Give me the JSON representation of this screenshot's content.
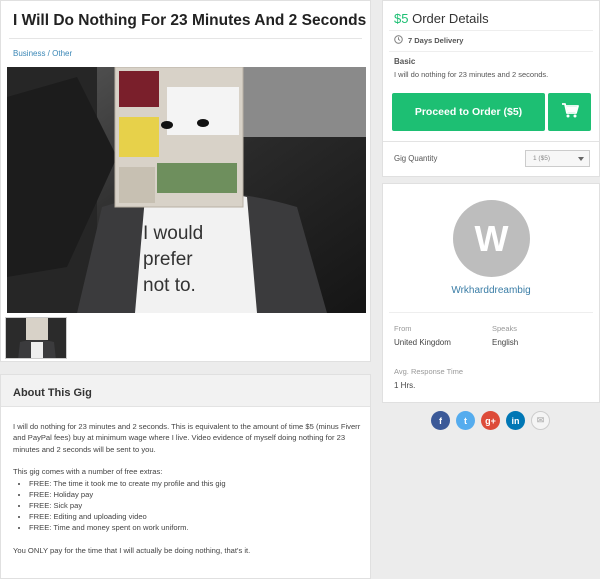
{
  "gig": {
    "title": "I Will Do Nothing For 23 Minutes And 2 Seconds",
    "breadcrumb": "Business / Other",
    "image_text": "I would prefer not to."
  },
  "about": {
    "heading": "About This Gig",
    "intro": "I will do nothing for 23 minutes and 2 seconds. This is equivalent to the amount of time $5 (minus Fiverr and PayPal fees) buy at minimum wage where I live. Video evidence of myself doing nothing for 23 minutes and 2 seconds will be sent to you.",
    "extras_intro": "This gig comes with a number of free extras:",
    "extras": [
      "FREE: The time it took me to create my profile and this gig",
      "FREE: Holiday pay",
      "FREE: Sick pay",
      "FREE: Editing and uploading video",
      "FREE: Time and money spent on work uniform."
    ],
    "closing": "You ONLY pay for the time that I will actually be doing nothing, that's it."
  },
  "order": {
    "price": "$5",
    "title": "Order Details",
    "delivery": "7 Days Delivery",
    "package_name": "Basic",
    "package_desc": "I will do nothing for 23 minutes and 2 seconds.",
    "button_label": "Proceed to Order ($5)",
    "quantity_label": "Gig Quantity",
    "quantity_value": "1 ($5)",
    "accent_color": "#1dbf73"
  },
  "seller": {
    "initial": "W",
    "name": "Wrkharddreambig",
    "from_label": "From",
    "from_value": "United Kingdom",
    "speaks_label": "Speaks",
    "speaks_value": "English",
    "response_label": "Avg. Response Time",
    "response_value": "1 Hrs."
  },
  "share": [
    {
      "icon": "facebook-icon",
      "glyph": "f",
      "color": "#3b5998"
    },
    {
      "icon": "twitter-icon",
      "glyph": "t",
      "color": "#55acee"
    },
    {
      "icon": "google-plus-icon",
      "glyph": "g+",
      "color": "#dd4b39"
    },
    {
      "icon": "linkedin-icon",
      "glyph": "in",
      "color": "#0077b5"
    },
    {
      "icon": "email-icon",
      "glyph": "✉",
      "color": "#eeeeee"
    }
  ]
}
